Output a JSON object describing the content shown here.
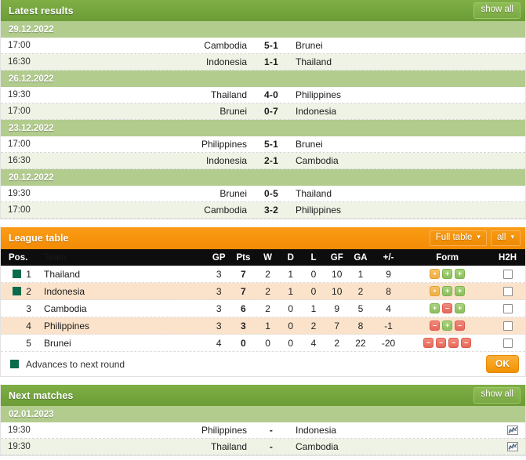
{
  "latest_results": {
    "title": "Latest results",
    "show_all_label": "show all",
    "groups": [
      {
        "date": "29.12.2022",
        "matches": [
          {
            "time": "17:00",
            "home": "Cambodia",
            "score": "5-1",
            "away": "Brunei"
          },
          {
            "time": "16:30",
            "home": "Indonesia",
            "score": "1-1",
            "away": "Thailand"
          }
        ]
      },
      {
        "date": "26.12.2022",
        "matches": [
          {
            "time": "19:30",
            "home": "Thailand",
            "score": "4-0",
            "away": "Philippines"
          },
          {
            "time": "17:00",
            "home": "Brunei",
            "score": "0-7",
            "away": "Indonesia"
          }
        ]
      },
      {
        "date": "23.12.2022",
        "matches": [
          {
            "time": "17:00",
            "home": "Philippines",
            "score": "5-1",
            "away": "Brunei"
          },
          {
            "time": "16:30",
            "home": "Indonesia",
            "score": "2-1",
            "away": "Cambodia"
          }
        ]
      },
      {
        "date": "20.12.2022",
        "matches": [
          {
            "time": "19:30",
            "home": "Brunei",
            "score": "0-5",
            "away": "Thailand"
          },
          {
            "time": "17:00",
            "home": "Cambodia",
            "score": "3-2",
            "away": "Philippines"
          }
        ]
      }
    ]
  },
  "league_table": {
    "title": "League table",
    "scope_select": {
      "value": "Full table",
      "caret": "▾"
    },
    "filter_select": {
      "value": "all",
      "caret": "▾"
    },
    "columns": {
      "pos": "Pos.",
      "team": "Team",
      "gp": "GP",
      "pts": "Pts",
      "w": "W",
      "d": "D",
      "l": "L",
      "gf": "GF",
      "ga": "GA",
      "diff": "+/-",
      "form": "Form",
      "h2h": "H2H"
    },
    "rows": [
      {
        "pos": "1",
        "team": "Thailand",
        "gp": "3",
        "pts": "7",
        "w": "2",
        "d": "1",
        "l": "0",
        "gf": "10",
        "ga": "1",
        "diff": "9",
        "advances": true,
        "form": [
          "d",
          "w",
          "w"
        ]
      },
      {
        "pos": "2",
        "team": "Indonesia",
        "gp": "3",
        "pts": "7",
        "w": "2",
        "d": "1",
        "l": "0",
        "gf": "10",
        "ga": "2",
        "diff": "8",
        "advances": true,
        "form": [
          "d",
          "w",
          "w"
        ]
      },
      {
        "pos": "3",
        "team": "Cambodia",
        "gp": "3",
        "pts": "6",
        "w": "2",
        "d": "0",
        "l": "1",
        "gf": "9",
        "ga": "5",
        "diff": "4",
        "advances": false,
        "form": [
          "w",
          "l",
          "w"
        ]
      },
      {
        "pos": "4",
        "team": "Philippines",
        "gp": "3",
        "pts": "3",
        "w": "1",
        "d": "0",
        "l": "2",
        "gf": "7",
        "ga": "8",
        "diff": "-1",
        "advances": false,
        "form": [
          "l",
          "w",
          "l"
        ]
      },
      {
        "pos": "5",
        "team": "Brunei",
        "gp": "4",
        "pts": "0",
        "w": "0",
        "d": "0",
        "l": "4",
        "gf": "2",
        "ga": "22",
        "diff": "-20",
        "advances": false,
        "form": [
          "l",
          "l",
          "l",
          "l"
        ]
      }
    ],
    "legend_label": "Advances to next round",
    "ok_label": "OK",
    "form_glyphs": {
      "w": "+",
      "d": "•",
      "l": "–"
    },
    "colors": {
      "header": "#f38b05",
      "advance_marker": "#0a6b4d",
      "form_win": "#8cbf5d",
      "form_draw": "#efae43",
      "form_loss": "#e8675a",
      "row_alt": "#fbe3cb"
    }
  },
  "next_matches": {
    "title": "Next matches",
    "show_all_label": "show all",
    "groups": [
      {
        "date": "02.01.2023",
        "matches": [
          {
            "time": "19:30",
            "home": "Philippines",
            "score": "-",
            "away": "Indonesia",
            "icon": "stats-chart-icon"
          },
          {
            "time": "19:30",
            "home": "Thailand",
            "score": "-",
            "away": "Cambodia",
            "icon": "stats-chart-icon"
          }
        ]
      }
    ]
  }
}
